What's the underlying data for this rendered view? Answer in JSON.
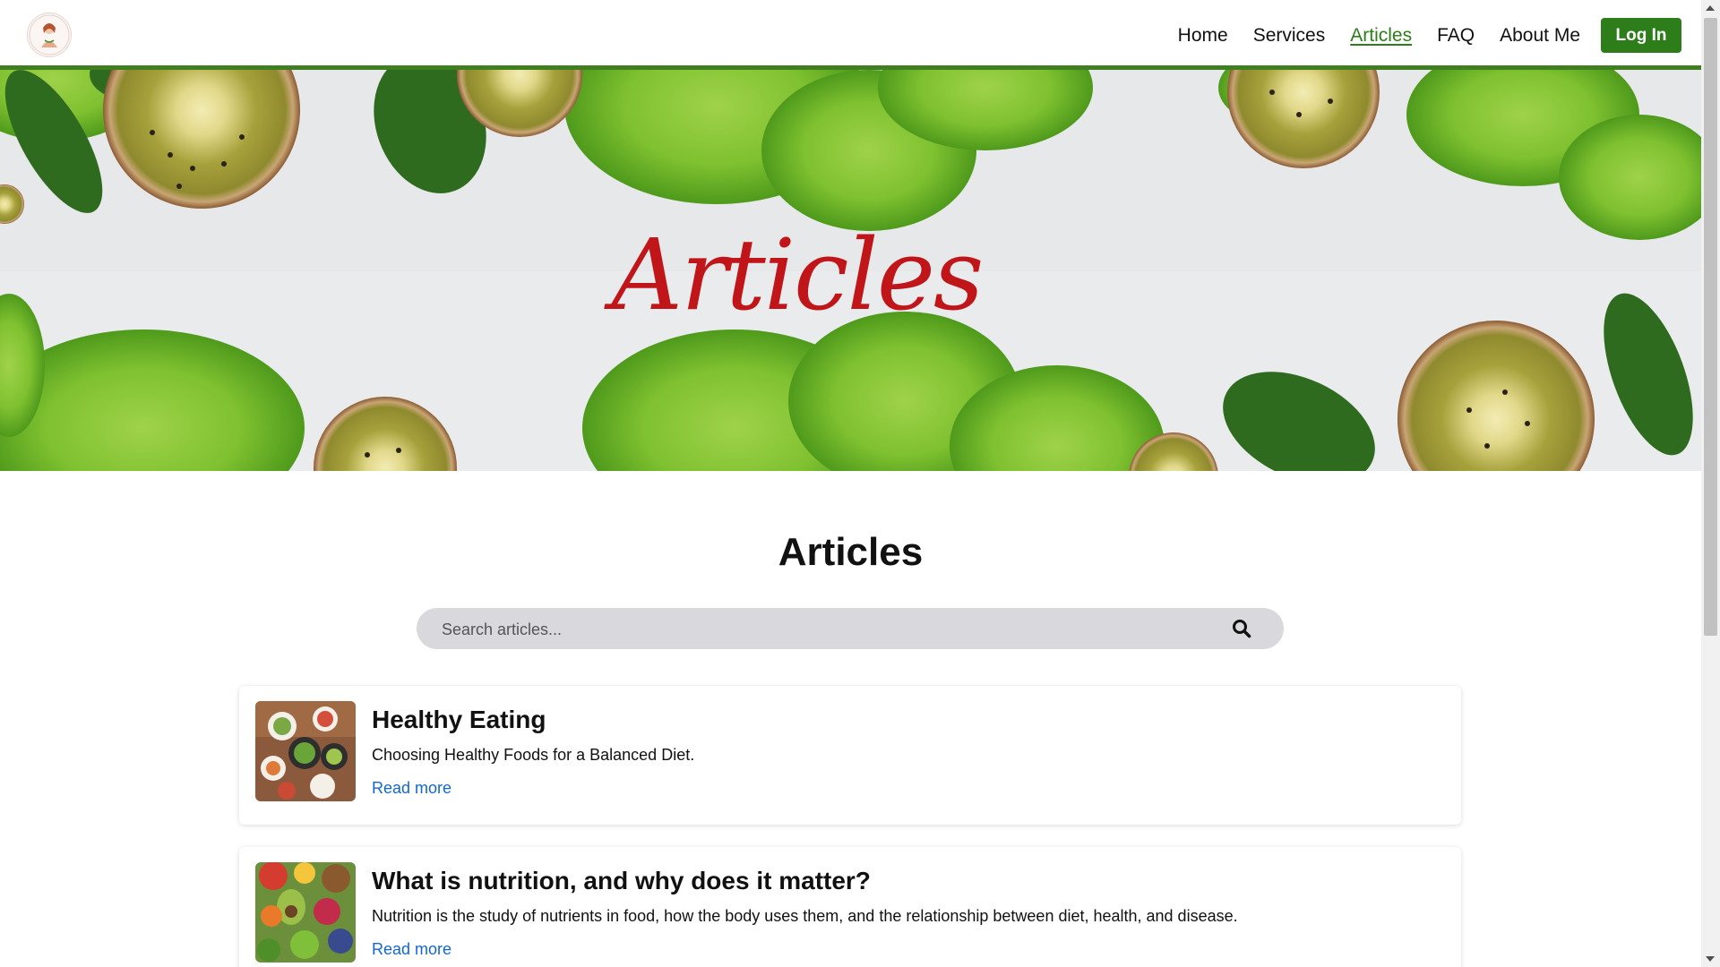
{
  "nav": {
    "items": [
      {
        "label": "Home",
        "active": false
      },
      {
        "label": "Services",
        "active": false
      },
      {
        "label": "Articles",
        "active": true
      },
      {
        "label": "FAQ",
        "active": false
      },
      {
        "label": "About Me",
        "active": false
      }
    ],
    "login_label": "Log In"
  },
  "hero": {
    "title": "Articles"
  },
  "main": {
    "title": "Articles",
    "search": {
      "placeholder": "Search articles..."
    },
    "articles": [
      {
        "title": "Healthy Eating",
        "summary": "Choosing Healthy Foods for a Balanced Diet.",
        "link_label": "Read more"
      },
      {
        "title": "What is nutrition, and why does it matter?",
        "summary": "Nutrition is the study of nutrients in food, how the body uses them, and the relationship between diet, health, and disease.",
        "link_label": "Read more"
      }
    ]
  },
  "colors": {
    "brand_green": "#2e7d1b",
    "hero_title_red": "#c0161a",
    "link_blue": "#1366d6"
  }
}
